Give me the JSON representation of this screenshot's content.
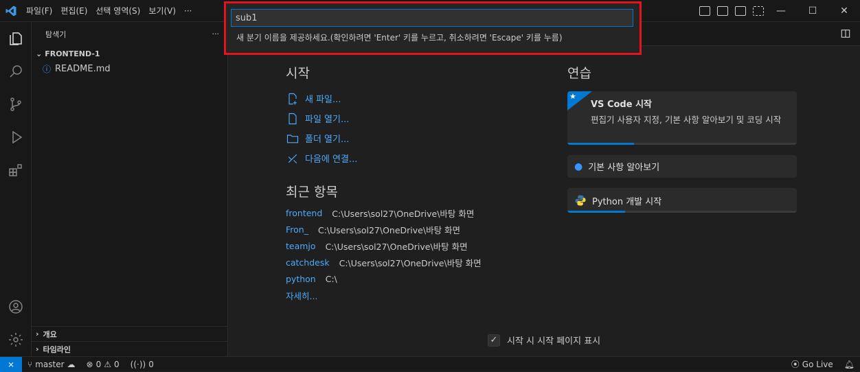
{
  "titlebar": {
    "menu": [
      "파일(F)",
      "편집(E)",
      "선택 영역(S)",
      "보기(V)",
      "···"
    ]
  },
  "quick_input": {
    "value": "sub1",
    "message": "새 분기 이름을 제공하세요.(확인하려면 'Enter' 키를 누르고, 취소하려면 'Escape' 키를 누름)"
  },
  "sidebar": {
    "title": "탐색기",
    "more": "···",
    "folder": "FRONTEND-1",
    "file": "README.md",
    "outline": "개요",
    "timeline": "타임라인"
  },
  "welcome": {
    "start_title": "시작",
    "actions": [
      "새 파일...",
      "파일 열기...",
      "폴더 열기...",
      "다음에 연결..."
    ],
    "recent_title": "최근 항목",
    "recent": [
      {
        "name": "frontend",
        "path": "C:\\Users\\sol27\\OneDrive\\바탕 화면"
      },
      {
        "name": "Fron_",
        "path": "C:\\Users\\sol27\\OneDrive\\바탕 화면"
      },
      {
        "name": "teamjo",
        "path": "C:\\Users\\sol27\\OneDrive\\바탕 화면"
      },
      {
        "name": "catchdesk",
        "path": "C:\\Users\\sol27\\OneDrive\\바탕 화면"
      },
      {
        "name": "python",
        "path": "C:\\"
      }
    ],
    "more": "자세히...",
    "walk_title": "연습",
    "walkthroughs": [
      {
        "title": "VS Code 시작",
        "desc": "편집기 사용자 지정, 기본 사항 알아보기 및 코딩 시작",
        "progress": 0.29
      },
      {
        "title": "기본 사항 알아보기"
      },
      {
        "title": "Python 개발 시작",
        "progress": 0.25
      }
    ],
    "show_on_startup": "시작 시 시작 페이지 표시"
  },
  "statusbar": {
    "branch": "master",
    "errors": "0",
    "warnings": "0",
    "ports": "0",
    "golive": "Go Live"
  },
  "colors": {
    "accent": "#0078d4",
    "link": "#4daafc",
    "highlight": "#e3141d"
  }
}
